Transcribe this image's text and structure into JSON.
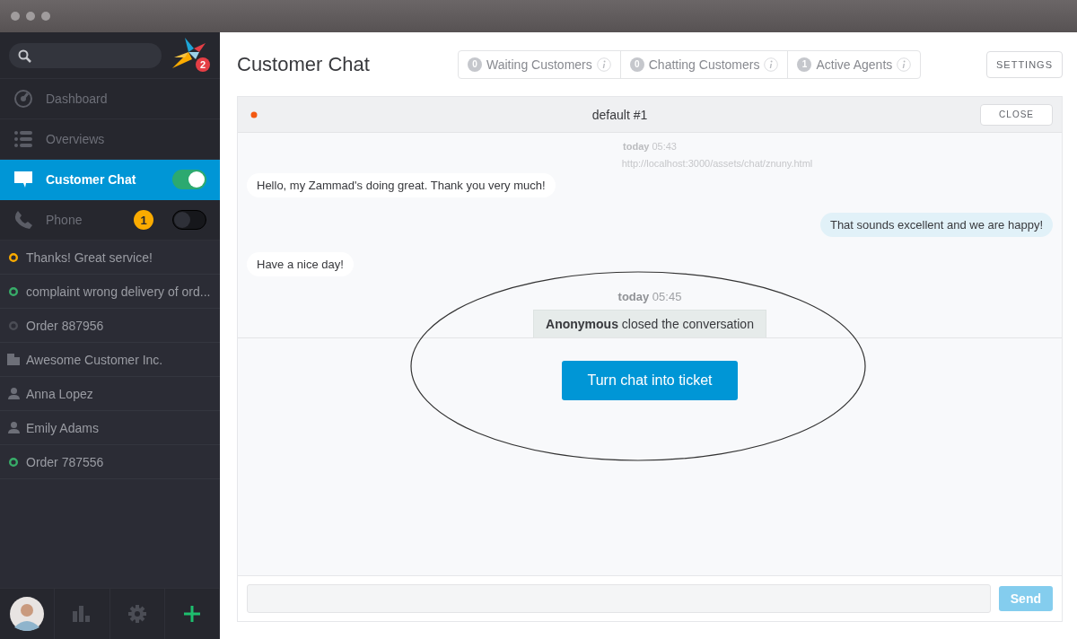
{
  "sidebar": {
    "notification_count": "2",
    "nav": [
      {
        "label": "Dashboard",
        "kind": "gauge",
        "selected": false
      },
      {
        "label": "Overviews",
        "kind": "list",
        "selected": false
      },
      {
        "label": "Customer Chat",
        "kind": "chat",
        "selected": true,
        "toggle_on": true
      },
      {
        "label": "Phone",
        "kind": "phone",
        "selected": false,
        "badge": "1",
        "toggle_on": false
      }
    ],
    "tasks": [
      {
        "label": "Thanks! Great service!",
        "kind": "ticket",
        "color": "#faab00"
      },
      {
        "label": "complaint wrong delivery of ord...",
        "kind": "ticket",
        "color": "#38ad69"
      },
      {
        "label": "Order 887956",
        "kind": "ticket",
        "color": "#4b4d55"
      },
      {
        "label": "Awesome Customer Inc.",
        "kind": "organization"
      },
      {
        "label": "Anna Lopez",
        "kind": "user"
      },
      {
        "label": "Emily Adams",
        "kind": "user"
      },
      {
        "label": "Order 787556",
        "kind": "ticket",
        "color": "#38ad69"
      }
    ]
  },
  "main": {
    "title": "Customer Chat",
    "stats": [
      {
        "count": "0",
        "label": "Waiting Customers"
      },
      {
        "count": "0",
        "label": "Chatting Customers"
      },
      {
        "count": "1",
        "label": "Active Agents"
      }
    ],
    "settings_button": "SETTINGS",
    "chat": {
      "title": "default #1",
      "customer_online": false,
      "close_button": "CLOSE",
      "messages": [
        {
          "kind": "timestamp",
          "text": "**today** 05:43"
        },
        {
          "kind": "url",
          "text": "http://localhost:3000/assets/chat/znuny.html"
        },
        {
          "kind": "customer",
          "text": "Hello, my Zammad's doing great. Thank you very much!"
        },
        {
          "kind": "agent",
          "text": "That sounds excellent and we are happy!"
        },
        {
          "kind": "customer",
          "text": "Have a nice day!"
        },
        {
          "kind": "timestamp",
          "text": "**today** 05:45"
        },
        {
          "kind": "status",
          "text": "**Anonymous** closed the conversation"
        }
      ],
      "action_button": "Turn chat into ticket",
      "send_button": {
        "label": "Send",
        "disabled": true
      }
    }
  }
}
